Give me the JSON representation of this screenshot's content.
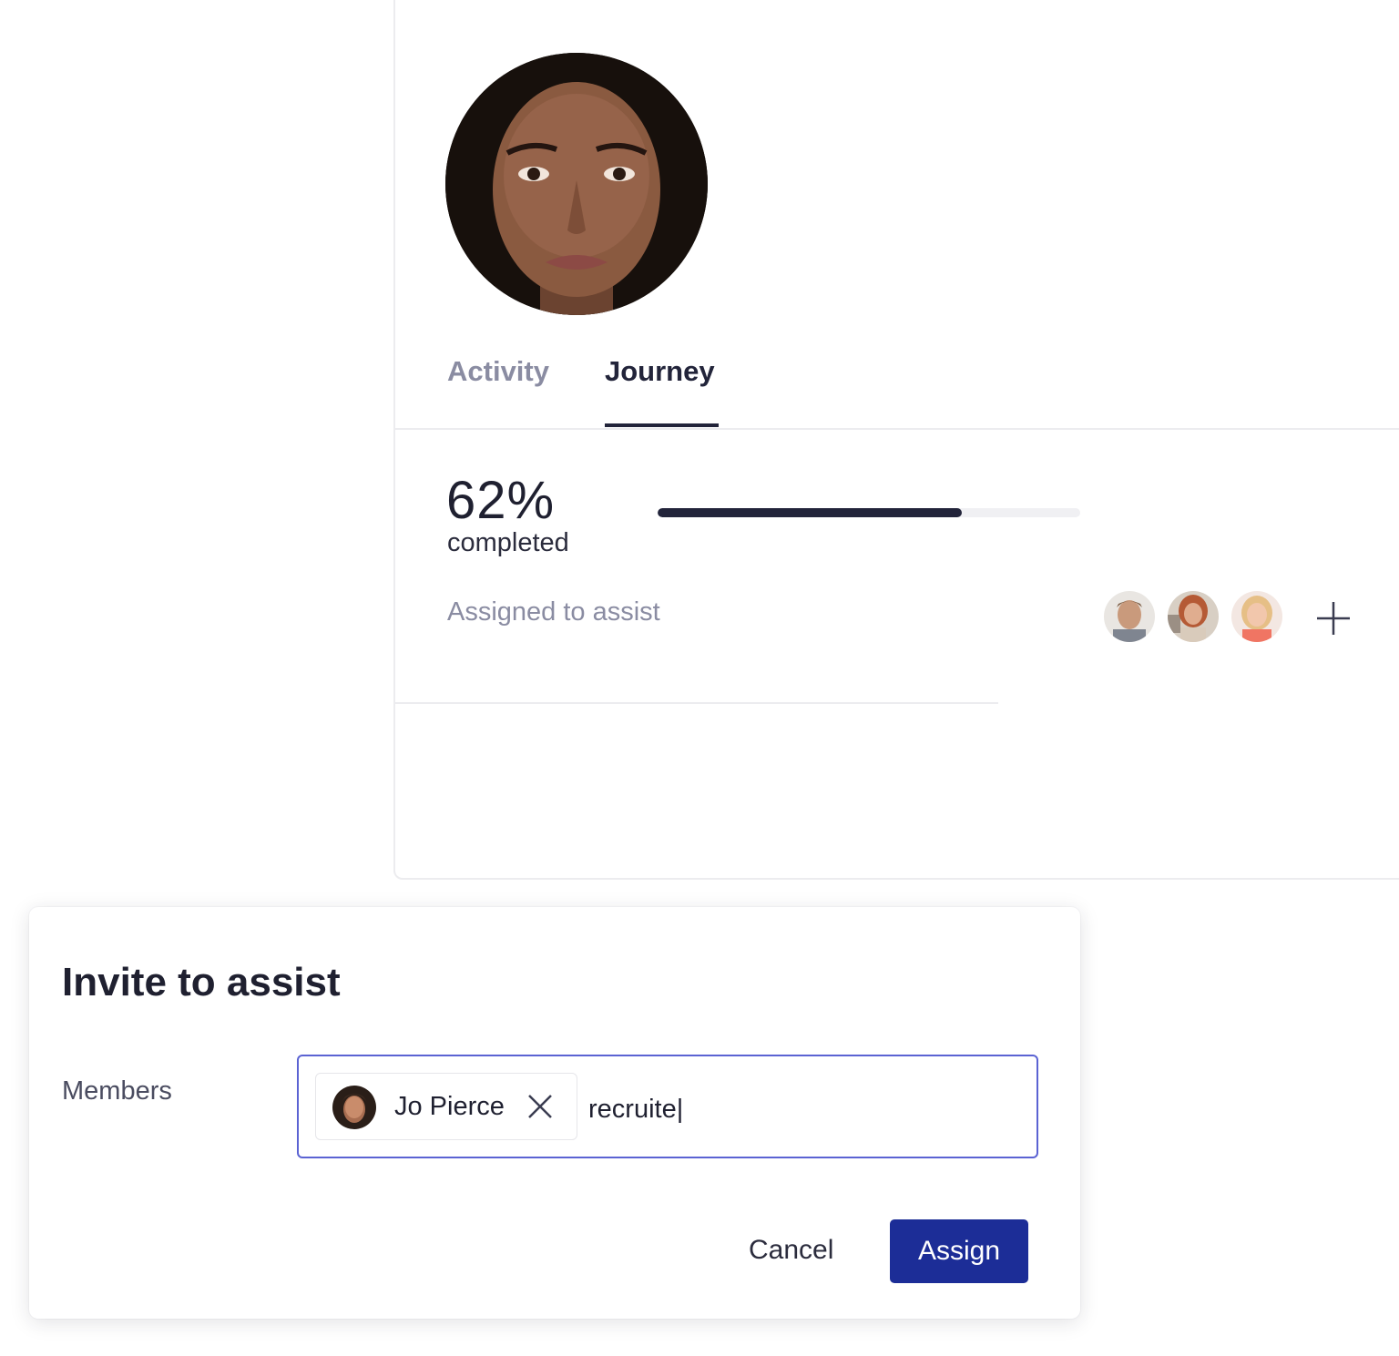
{
  "profile": {
    "avatar": "woman-portrait",
    "tabs": [
      {
        "label": "Activity",
        "active": false
      },
      {
        "label": "Journey",
        "active": true
      }
    ],
    "progress": {
      "percent_label": "62%",
      "caption": "completed",
      "fraction": 0.72
    },
    "assigned_label": "Assigned to assist",
    "assignees": [
      {
        "avatar": "man-portrait"
      },
      {
        "avatar": "woman-redhead-portrait"
      },
      {
        "avatar": "woman-blonde-portrait"
      }
    ],
    "add_icon": "plus-icon"
  },
  "invite_modal": {
    "title": "Invite to assist",
    "members_label": "Members",
    "selected_members": [
      {
        "name": "Jo Pierce",
        "avatar": "woman-portrait",
        "remove_icon": "close-icon"
      }
    ],
    "input_value": "recruite|",
    "cancel_label": "Cancel",
    "assign_label": "Assign"
  },
  "colors": {
    "primary": "#1c2d97",
    "focus_border": "#5b63d3",
    "text_dark": "#1f2030",
    "text_muted": "#8a8ca2",
    "progress_fill": "#22243a",
    "progress_track": "#f0f0f3"
  }
}
